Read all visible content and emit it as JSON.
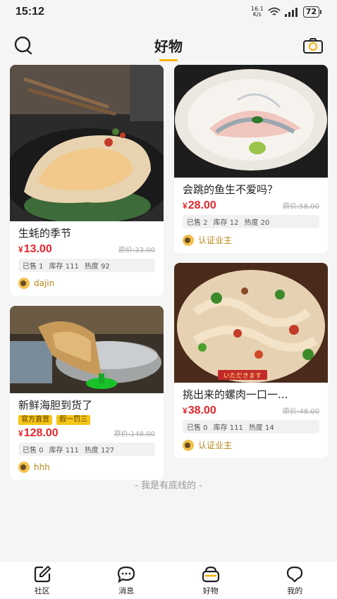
{
  "status_bar": {
    "time": "15:12",
    "net_speed_value": "16.1",
    "net_speed_unit": "K/s",
    "battery": "72"
  },
  "header": {
    "title": "好物",
    "left_icon": "search-icon",
    "right_icon": "camera-icon"
  },
  "feed": {
    "left": [
      {
        "title": "生蚝的季节",
        "price": "13.00",
        "original_price": "原价:33.00",
        "sold": "已售 1",
        "stock": "库存 111",
        "heat": "热度 92",
        "author": "dajin",
        "tags": []
      },
      {
        "title": "新鲜海胆到货了",
        "price": "128.00",
        "original_price": "原价:148.00",
        "sold": "已售 0",
        "stock": "库存 111",
        "heat": "热度 127",
        "author": "hhh",
        "tags": [
          "官方直营",
          "假一罚三"
        ]
      }
    ],
    "right": [
      {
        "title": "会跳的鱼生不爱吗？",
        "price": "28.00",
        "original_price": "原价:58.00",
        "sold": "已售 2",
        "stock": "库存 12",
        "heat": "热度 20",
        "author": "认证业主",
        "tags": []
      },
      {
        "title": "挑出来的螺肉一口一...",
        "price": "38.00",
        "original_price": "原价:48.00",
        "sold": "已售 0",
        "stock": "库存 111",
        "heat": "热度 14",
        "author": "认证业主",
        "tags": [],
        "image_caption": "いただきます"
      }
    ]
  },
  "currency_symbol": "¥",
  "end_text": "- 我是有底线的 -",
  "bottom_nav": {
    "items": [
      {
        "label": "社区",
        "icon": "edit-icon"
      },
      {
        "label": "消息",
        "icon": "message-icon"
      },
      {
        "label": "好物",
        "icon": "basket-icon"
      },
      {
        "label": "我的",
        "icon": "profile-icon"
      }
    ]
  },
  "colors": {
    "accent": "#f5b301",
    "price": "#e3262d",
    "tag": "#f5c518",
    "author": "#b7861a"
  }
}
